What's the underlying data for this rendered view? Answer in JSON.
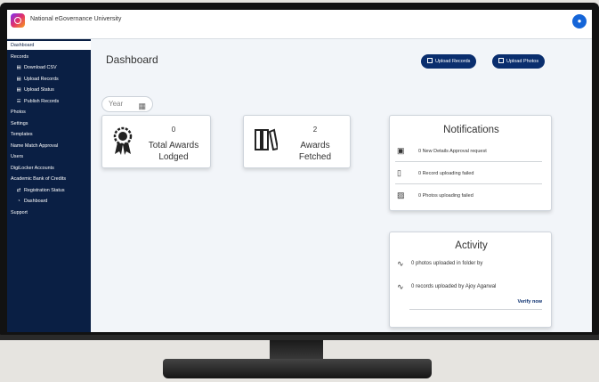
{
  "header": {
    "app_title": "National eGovernance University"
  },
  "sidebar": {
    "items": [
      {
        "label": "Dashboard",
        "name": "sidebar-item-dashboard",
        "active": true
      },
      {
        "label": "Records",
        "name": "sidebar-item-records"
      },
      {
        "label": "Download CSV",
        "name": "sidebar-item-download-csv",
        "sub": true,
        "icon": "document-icon"
      },
      {
        "label": "Upload Records",
        "name": "sidebar-item-upload-records",
        "sub": true,
        "icon": "document-icon"
      },
      {
        "label": "Upload Status",
        "name": "sidebar-item-upload-status",
        "sub": true,
        "icon": "document-icon"
      },
      {
        "label": "Publish Records",
        "name": "sidebar-item-publish-records",
        "sub": true,
        "icon": "list-icon"
      },
      {
        "label": "Photos",
        "name": "sidebar-item-photos"
      },
      {
        "label": "Settings",
        "name": "sidebar-item-settings"
      },
      {
        "label": "Templates",
        "name": "sidebar-item-templates"
      },
      {
        "label": "Name Match Approval",
        "name": "sidebar-item-name-match-approval"
      },
      {
        "label": "Users",
        "name": "sidebar-item-users"
      },
      {
        "label": "DigiLocker Accounts",
        "name": "sidebar-item-digilocker-accounts"
      },
      {
        "label": "Academic Bank of Credits",
        "name": "sidebar-item-academic-bank-of-credits"
      },
      {
        "label": "Registration Status",
        "name": "sidebar-item-registration-status",
        "sub": true,
        "icon": "transfer-icon"
      },
      {
        "label": "Dashboard",
        "name": "sidebar-item-abc-dashboard",
        "sub": true,
        "icon": "pie-icon"
      },
      {
        "label": "Support",
        "name": "sidebar-item-support"
      }
    ]
  },
  "main": {
    "title": "Dashboard",
    "upload_records_label": "Upload Records",
    "upload_photos_label": "Upload Photos",
    "year_placeholder": "Year",
    "stats": [
      {
        "value": "0",
        "label_line1": "Total Awards",
        "label_line2": "Lodged",
        "icon": "award-ribbon-icon"
      },
      {
        "value": "2",
        "label_line1": "Awards",
        "label_line2": "Fetched",
        "icon": "books-icon"
      }
    ],
    "notifications": {
      "title": "Notifications",
      "items": [
        {
          "text": "0 New Details Approval request",
          "icon": "inbox-icon"
        },
        {
          "text": "0 Record uploading failed",
          "icon": "file-icon"
        },
        {
          "text": "0 Photos uploading failed",
          "icon": "image-icon"
        }
      ]
    },
    "activity": {
      "title": "Activity",
      "items": [
        {
          "text": "0 photos uploaded in folder by",
          "icon": "activity-icon"
        },
        {
          "text": "0 records uploaded by Ajoy Agarwal",
          "icon": "activity-icon"
        }
      ],
      "verify_label": "Verify now"
    }
  }
}
